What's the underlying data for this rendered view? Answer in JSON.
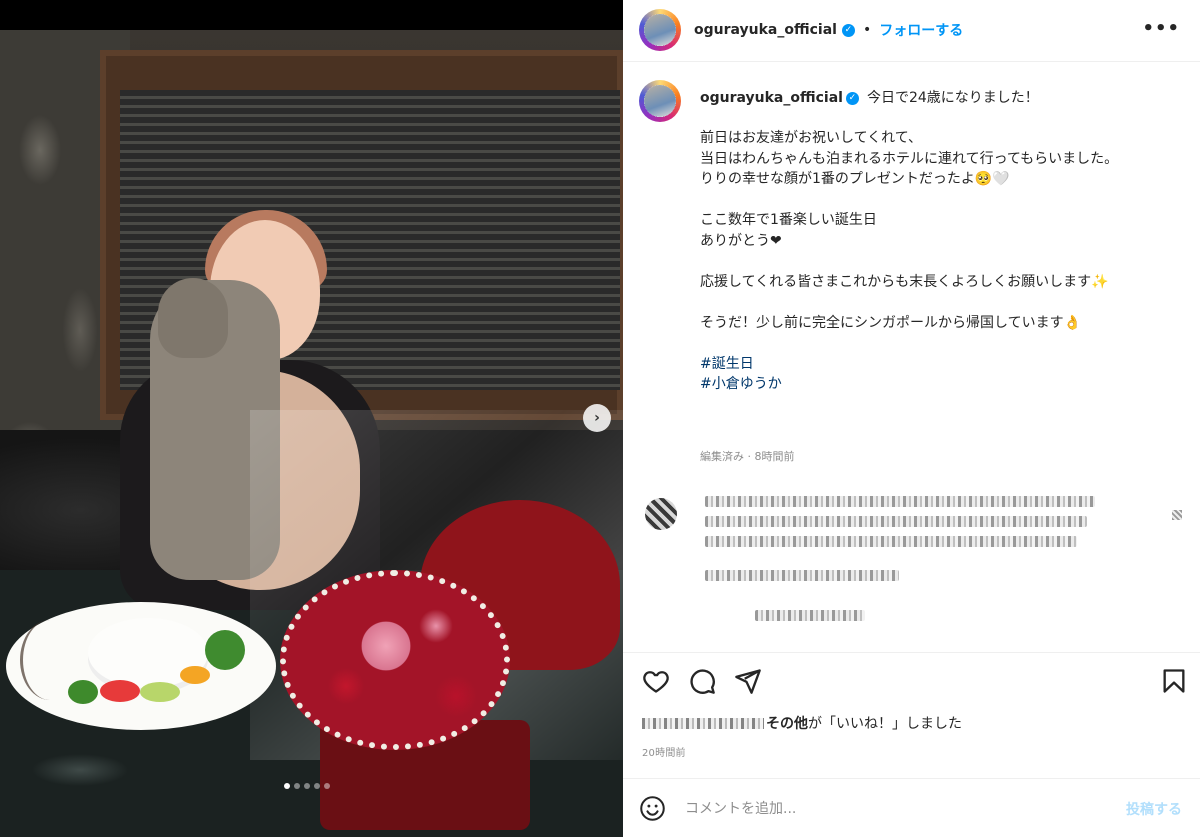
{
  "post": {
    "username": "ogurayuka_official",
    "verified_icon": "verified-badge-icon",
    "separator": "•",
    "follow_label": "フォローする",
    "more_label": "•••",
    "carousel": {
      "slide_count": 5,
      "active_slide": 1
    }
  },
  "caption": {
    "username": "ogurayuka_official",
    "first_line": "今日で24歳になりました！",
    "body": "前日はお友達がお祝いしてくれて、\n当日はわんちゃんも泊まれるホテルに連れて行ってもらいました。\nりりの幸せな顔が1番のプレゼントだったよ🥺🤍\n\nここ数年で1番楽しい誕生日\nありがとう❤\n\n応援してくれる皆さまこれからも末長くよろしくお願いします✨\n\nそうだ！少し前に完全にシンガポールから帰国しています👌",
    "hashtags": [
      "#誕生日",
      "#小倉ゆうか"
    ],
    "meta": "編集済み · 8時間前"
  },
  "likes": {
    "others_label": "その他",
    "suffix": "が「いいね！」しました",
    "time": "20時間前"
  },
  "comment_box": {
    "placeholder": "コメントを追加...",
    "post_label": "投稿する"
  },
  "colors": {
    "accent": "#0095f6",
    "hashtag": "#00376b",
    "muted": "#8e8e8e"
  }
}
